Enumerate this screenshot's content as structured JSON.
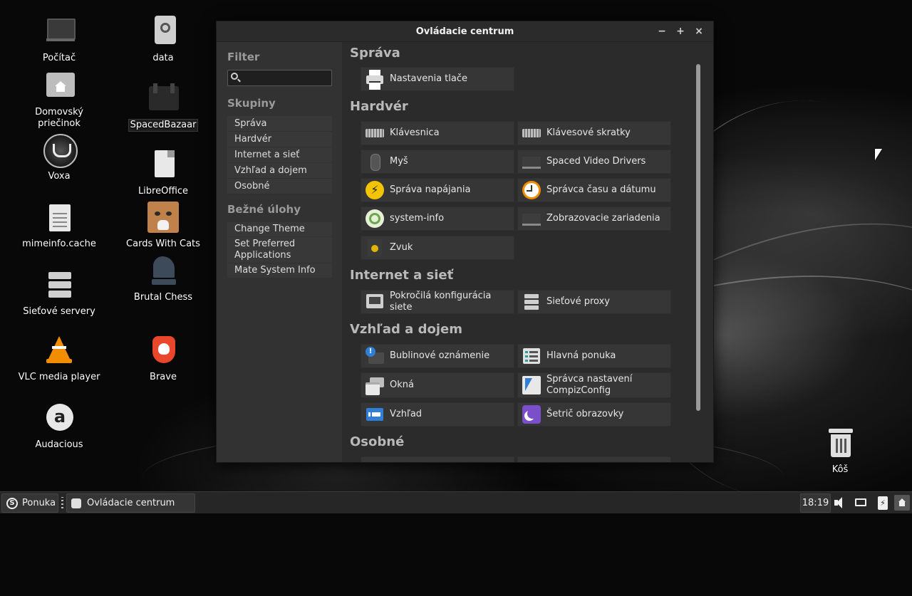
{
  "window": {
    "title": "Ovládacie centrum",
    "buttons": {
      "minimize": "−",
      "maximize": "+",
      "close": "×"
    }
  },
  "sidebar": {
    "filter_heading": "Filter",
    "search_placeholder": "",
    "groups_heading": "Skupiny",
    "groups": [
      "Správa",
      "Hardvér",
      "Internet a sieť",
      "Vzhľad a dojem",
      "Osobné"
    ],
    "tasks_heading": "Bežné úlohy",
    "tasks": [
      "Change Theme",
      "Set Preferred Applications",
      "Mate System Info"
    ]
  },
  "sections": [
    {
      "title": "Správa",
      "items": [
        "Nastavenia tlače"
      ]
    },
    {
      "title": "Hardvér",
      "items": [
        "Klávesnica",
        "Klávesové skratky",
        "Myš",
        "Spaced Video Drivers",
        "Správa napájania",
        "Správca času a dátumu",
        "system-info",
        "Zobrazovacie zariadenia",
        "Zvuk"
      ]
    },
    {
      "title": "Internet a sieť",
      "items": [
        "Pokročilá konfigurácia siete",
        "Sieťové proxy"
      ]
    },
    {
      "title": "Vzhľad a dojem",
      "items": [
        "Bublinové oznámenie",
        "Hlavná ponuka",
        "Okná",
        "Správca nastavení CompizConfig",
        "Vzhľad",
        "Šetrič obrazovky"
      ]
    },
    {
      "title": "Osobné",
      "items": []
    }
  ],
  "desktop": {
    "icons_left": [
      "Počítač",
      "Domovský priečinok",
      "Voxa",
      "mimeinfo.cache",
      "Sieťové servery",
      "VLC media player",
      "Audacious"
    ],
    "icons_right": [
      "data",
      "SpacedBazaar",
      "LibreOffice",
      "Cards With Cats",
      "Brutal Chess",
      "Brave"
    ],
    "trash": "Kôš"
  },
  "taskbar": {
    "menu_label": "Ponuka",
    "task_label": "Ovládacie centrum",
    "clock": "18:19"
  },
  "colors": {
    "window_bg": "#2b2b2b",
    "sidebar_bg": "#323232",
    "tile_bg": "#363636",
    "heading": "#b9b9b9",
    "accent_yellow": "#f5c400",
    "accent_orange": "#f08a00",
    "accent_blue": "#2f7fd8",
    "accent_purple": "#7a4fc9"
  },
  "icons": {
    "tiles": [
      "printer-icon",
      "keyboard-icon",
      "keyboard-shortcuts-icon",
      "mouse-icon",
      "monitor-icon",
      "power-icon",
      "clock-icon",
      "system-info-icon",
      "display-icon",
      "speaker-icon",
      "network-icon",
      "proxy-icon",
      "notification-icon",
      "main-menu-icon",
      "windows-icon",
      "compiz-icon",
      "appearance-icon",
      "screensaver-icon"
    ]
  }
}
